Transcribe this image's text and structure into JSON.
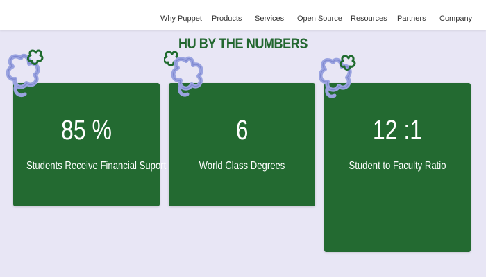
{
  "nav": {
    "items": [
      "Why Puppet",
      "Products",
      "Services",
      "Open Source",
      "Resources",
      "Partners",
      "Company"
    ]
  },
  "section": {
    "title": "HU BY THE NUMBERS"
  },
  "stats": [
    {
      "value": "85 %",
      "label": "Students Receive Financial Suport"
    },
    {
      "value": "6",
      "label": "World Class Degrees"
    },
    {
      "value": "12 :1",
      "label": "Student to Faculty Ratio"
    }
  ],
  "colors": {
    "background": "#e8e6f5",
    "card_green": "#236a31",
    "title_green": "#22672f",
    "flower_blue": "#9aa3e0",
    "flower_green": "#1f6b2e"
  },
  "icons": {
    "decoration": "flower-doodle-icon"
  }
}
